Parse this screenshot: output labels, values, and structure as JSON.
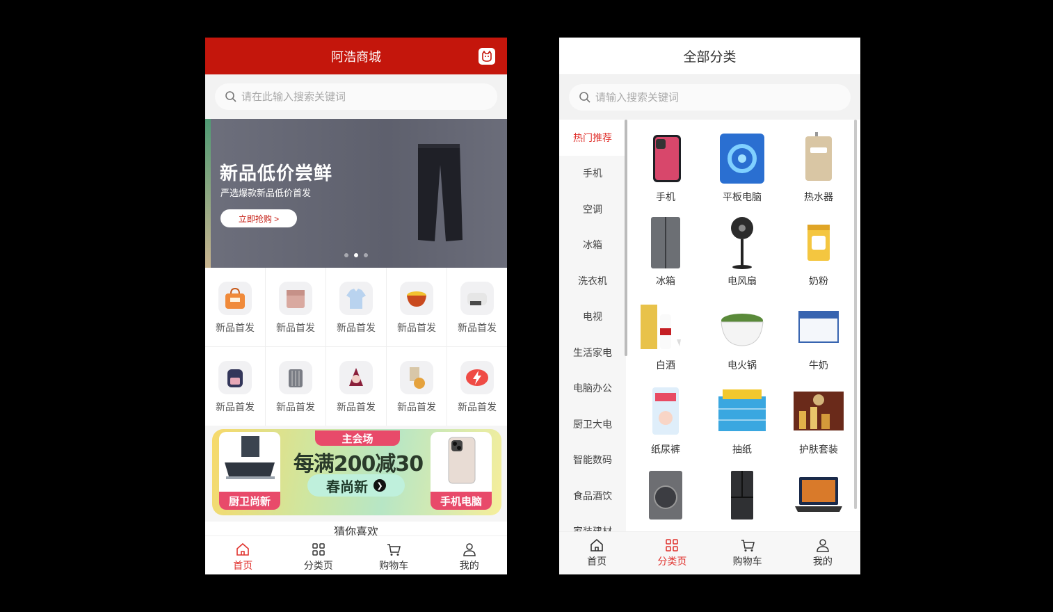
{
  "home": {
    "title": "阿浩商城",
    "search_placeholder": "请在此输入搜索关键词",
    "banner": {
      "title": "新品低价尝鲜",
      "subtitle": "严选爆款新品低价首发",
      "button": "立即抢购 >"
    },
    "grid_items": [
      {
        "label": "新品首发",
        "icon": "handbag-icon"
      },
      {
        "label": "新品首发",
        "icon": "bedding-icon"
      },
      {
        "label": "新品首发",
        "icon": "shirt-icon"
      },
      {
        "label": "新品首发",
        "icon": "noodles-icon"
      },
      {
        "label": "新品首发",
        "icon": "pillow-icon"
      },
      {
        "label": "新品首发",
        "icon": "backpack-icon"
      },
      {
        "label": "新品首发",
        "icon": "suitcase-icon"
      },
      {
        "label": "新品首发",
        "icon": "figurine-icon"
      },
      {
        "label": "新品首发",
        "icon": "snack-icon"
      },
      {
        "label": "新品首发",
        "icon": "lightning-icon"
      }
    ],
    "promo": {
      "tag": "主会场",
      "headline": "每满200减30",
      "sub": "春尚新",
      "left_label": "厨卫尚新",
      "right_label": "手机电脑"
    },
    "guess_title": "猜你喜欢"
  },
  "category": {
    "title": "全部分类",
    "search_placeholder": "请输入搜索关键词",
    "sidebar": [
      "热门推荐",
      "手机",
      "空调",
      "冰箱",
      "洗衣机",
      "电视",
      "生活家电",
      "电脑办公",
      "厨卫大电",
      "智能数码",
      "食品酒饮",
      "家装建材"
    ],
    "items": [
      {
        "label": "手机",
        "icon": "phone-icon"
      },
      {
        "label": "平板电脑",
        "icon": "tablet-icon"
      },
      {
        "label": "热水器",
        "icon": "water-heater-icon"
      },
      {
        "label": "冰箱",
        "icon": "fridge-icon"
      },
      {
        "label": "电风扇",
        "icon": "fan-icon"
      },
      {
        "label": "奶粉",
        "icon": "milk-powder-icon"
      },
      {
        "label": "白酒",
        "icon": "liquor-icon"
      },
      {
        "label": "电火锅",
        "icon": "hotpot-icon"
      },
      {
        "label": "牛奶",
        "icon": "milk-icon"
      },
      {
        "label": "纸尿裤",
        "icon": "diaper-icon"
      },
      {
        "label": "抽纸",
        "icon": "tissue-icon"
      },
      {
        "label": "护肤套装",
        "icon": "skincare-icon"
      },
      {
        "label": "",
        "icon": "washer-icon"
      },
      {
        "label": "",
        "icon": "fridge2-icon"
      },
      {
        "label": "",
        "icon": "laptop-icon"
      }
    ]
  },
  "tabs": [
    {
      "label": "首页",
      "icon": "home-icon"
    },
    {
      "label": "分类页",
      "icon": "category-icon"
    },
    {
      "label": "购物车",
      "icon": "cart-icon"
    },
    {
      "label": "我的",
      "icon": "user-icon"
    }
  ],
  "colors": {
    "brand_red": "#c4160c",
    "active_red": "#e0322d"
  }
}
